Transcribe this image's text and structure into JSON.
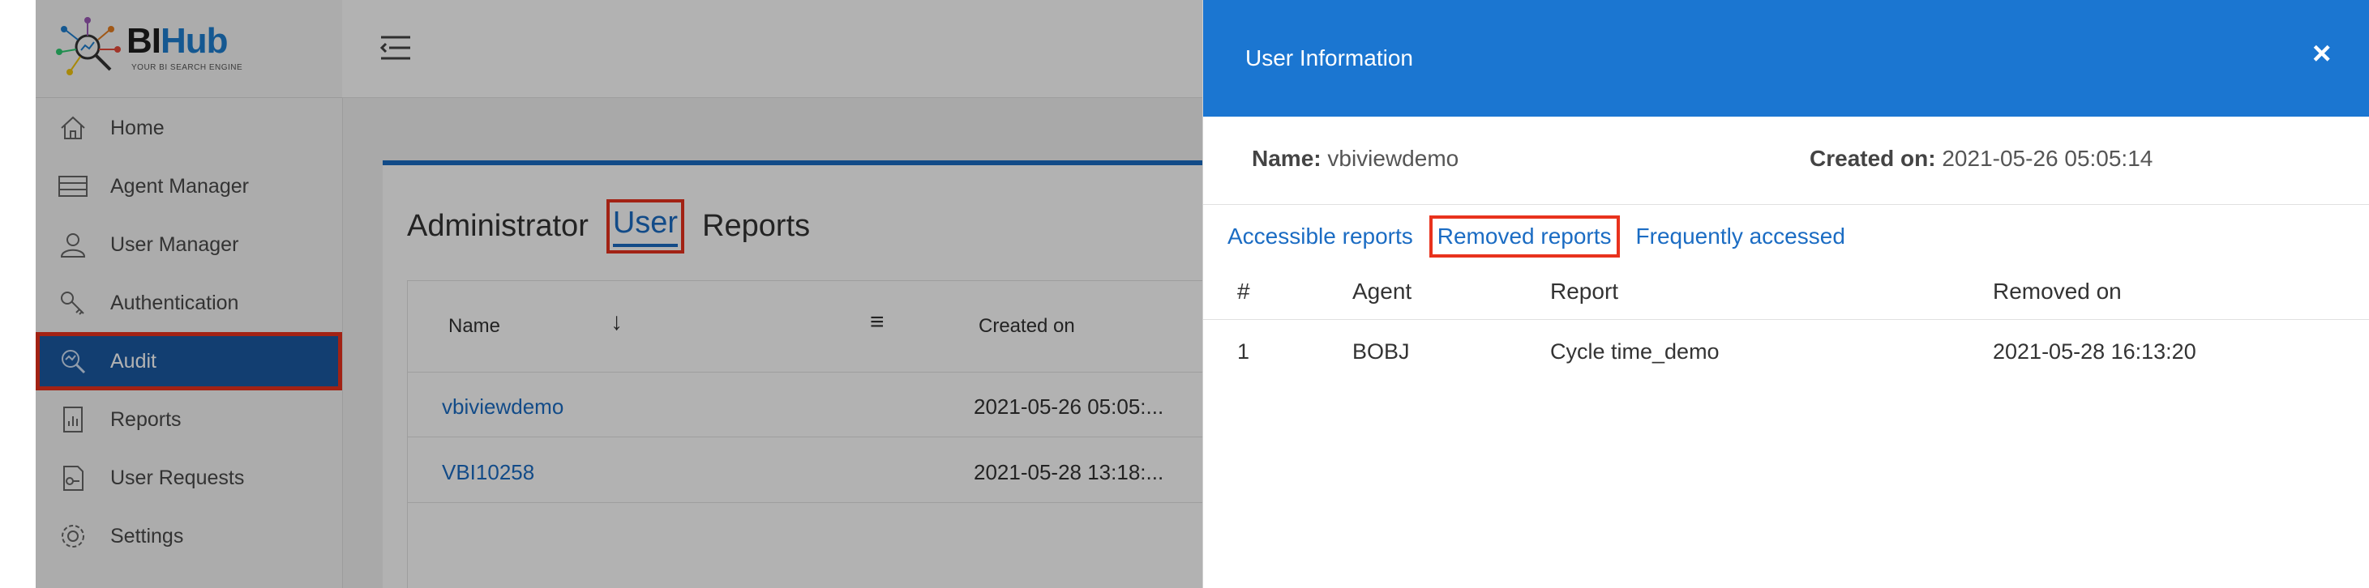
{
  "brand": {
    "name_bi": "BI",
    "name_hub": "Hub",
    "tagline": "YOUR BI SEARCH ENGINE"
  },
  "sidebar": {
    "items": [
      {
        "label": "Home",
        "icon": "home-icon"
      },
      {
        "label": "Agent Manager",
        "icon": "server-icon"
      },
      {
        "label": "User Manager",
        "icon": "user-icon"
      },
      {
        "label": "Authentication",
        "icon": "key-icon"
      },
      {
        "label": "Audit",
        "icon": "audit-search-icon",
        "active": true
      },
      {
        "label": "Reports",
        "icon": "report-icon"
      },
      {
        "label": "User Requests",
        "icon": "request-icon"
      },
      {
        "label": "Settings",
        "icon": "gear-icon"
      }
    ]
  },
  "main": {
    "tabs": [
      {
        "label": "Administrator"
      },
      {
        "label": "User",
        "active": true
      },
      {
        "label": "Reports"
      }
    ],
    "table": {
      "headers": {
        "name": "Name",
        "created": "Created on"
      },
      "rows": [
        {
          "name": "vbiviewdemo",
          "created": "2021-05-26 05:05:..."
        },
        {
          "name": "VBI10258",
          "created": "2021-05-28 13:18:..."
        }
      ]
    }
  },
  "panel": {
    "title": "User Information",
    "close": "×",
    "name_label": "Name:",
    "name_value": "vbiviewdemo",
    "created_label": "Created on:",
    "created_value": "2021-05-26 05:05:14",
    "tabs": [
      {
        "label": "Accessible reports"
      },
      {
        "label": "Removed reports",
        "selected": true
      },
      {
        "label": "Frequently accessed"
      }
    ],
    "table": {
      "headers": [
        "#",
        "Agent",
        "Report",
        "Removed on"
      ],
      "rows": [
        [
          "1",
          "BOBJ",
          "Cycle time_demo",
          "2021-05-28 16:13:20"
        ]
      ]
    }
  },
  "colors": {
    "accent": "#1b76d1",
    "highlight": "#e8321d",
    "active_nav": "#1b5aa3"
  }
}
